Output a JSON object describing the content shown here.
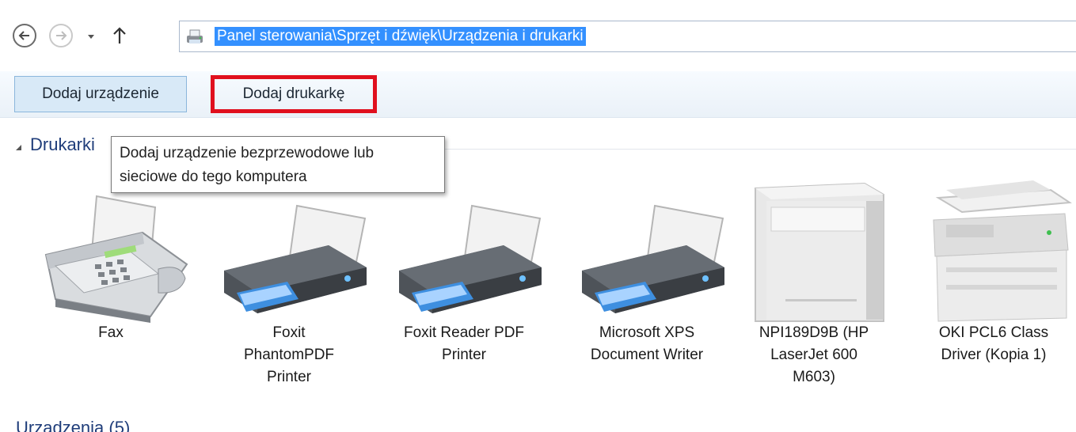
{
  "navigation": {
    "back_icon": "arrow-left-circle-icon",
    "forward_icon": "arrow-right-circle-icon",
    "recent_icon": "chevron-down-icon",
    "up_icon": "arrow-up-icon",
    "address_icon": "devices-and-printers-icon",
    "address": "Panel sterowania\\Sprzęt i dźwięk\\Urządzenia i drukarki"
  },
  "toolbar": {
    "add_device_label": "Dodaj urządzenie",
    "add_printer_label": "Dodaj drukarkę",
    "highlight_color": "#e0101e"
  },
  "section": {
    "title": "Drukarki",
    "tooltip": "Dodaj urządzenie bezprzewodowe lub\nsieciowe do tego komputera"
  },
  "devices": [
    {
      "label": "Fax",
      "icon": "fax-icon"
    },
    {
      "label": "Foxit\nPhantomPDF\nPrinter",
      "icon": "printer-icon"
    },
    {
      "label": "Foxit Reader PDF\nPrinter",
      "icon": "printer-icon"
    },
    {
      "label": "Microsoft XPS\nDocument Writer",
      "icon": "printer-icon"
    },
    {
      "label": "NPI189D9B (HP\nLaserJet 600\nM603)",
      "icon": "laser-printer-icon"
    },
    {
      "label": "OKI PCL6 Class\nDriver (Kopia 1)",
      "icon": "multifunction-printer-icon"
    }
  ],
  "next_section": "Urządzenia (5)",
  "colors": {
    "selection": "#3390ff",
    "section_title": "#1f3d7a",
    "button_bg": "#d8e9f7"
  }
}
